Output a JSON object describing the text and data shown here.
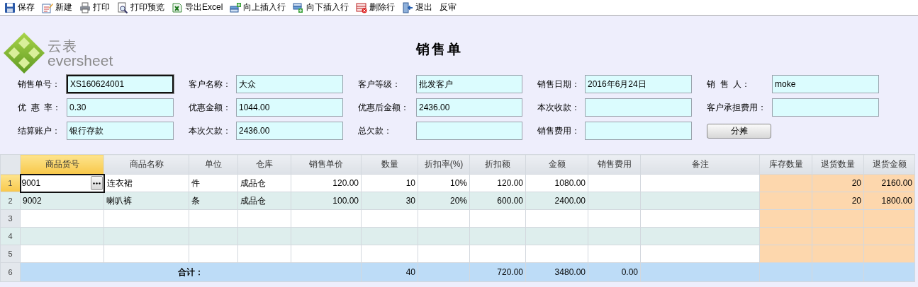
{
  "toolbar": [
    {
      "kind": "save",
      "label": "保存"
    },
    {
      "kind": "new",
      "label": "新建"
    },
    {
      "kind": "print",
      "label": "打印"
    },
    {
      "kind": "preview",
      "label": "打印预览"
    },
    {
      "kind": "excel",
      "label": "导出Excel"
    },
    {
      "kind": "insert-above",
      "label": "向上插入行"
    },
    {
      "kind": "insert-below",
      "label": "向下插入行"
    },
    {
      "kind": "delete-row",
      "label": "删除行"
    },
    {
      "kind": "exit",
      "label": "退出"
    },
    {
      "kind": "plain",
      "label": "反审"
    }
  ],
  "logo": {
    "mark": "云表",
    "name": "eversheet"
  },
  "title": "销售单",
  "form": {
    "rows": [
      [
        {
          "kind": "field",
          "label": "销售单号：",
          "value": "XS160624001",
          "focused": true
        },
        {
          "kind": "field",
          "label": "客户名称：",
          "value": "大众",
          "focused": false
        },
        {
          "kind": "field",
          "label": "客户等级：",
          "value": "批发客户",
          "focused": false
        },
        {
          "kind": "field",
          "label": "销售日期：",
          "value": "2016年6月24日",
          "focused": false
        },
        {
          "kind": "field",
          "label": "销  售  人：",
          "value": "moke",
          "focused": false
        }
      ],
      [
        {
          "kind": "field",
          "label": "优  惠  率：",
          "value": "0.30",
          "focused": false
        },
        {
          "kind": "field",
          "label": "优惠金额：",
          "value": "1044.00",
          "focused": false
        },
        {
          "kind": "field",
          "label": "优惠后金额：",
          "value": "2436.00",
          "focused": false
        },
        {
          "kind": "field",
          "label": "本次收款：",
          "focused": false
        },
        {
          "kind": "field",
          "label": "客户承担费用：",
          "focused": false
        }
      ],
      [
        {
          "kind": "field",
          "label": "结算账户：",
          "value": "银行存款",
          "focused": false
        },
        {
          "kind": "field",
          "label": "本次欠款：",
          "value": "2436.00",
          "focused": false
        },
        {
          "kind": "field",
          "label": "总欠款：",
          "focused": false
        },
        {
          "kind": "field",
          "label": "销售费用：",
          "focused": false
        },
        {
          "kind": "button",
          "label": "分摊"
        }
      ]
    ]
  },
  "table": {
    "columns": [
      {
        "label": "商品货号",
        "kind": "text",
        "selected": true,
        "highlighted": false
      },
      {
        "label": "商品名称",
        "kind": "text",
        "selected": false,
        "highlighted": false
      },
      {
        "label": "单位",
        "kind": "text",
        "selected": false,
        "highlighted": false
      },
      {
        "label": "仓库",
        "kind": "text",
        "selected": false,
        "highlighted": false
      },
      {
        "label": "销售单价",
        "kind": "number",
        "selected": false,
        "highlighted": false
      },
      {
        "label": "数量",
        "kind": "number",
        "selected": false,
        "highlighted": false
      },
      {
        "label": "折扣率(%)",
        "kind": "number",
        "selected": false,
        "highlighted": false
      },
      {
        "label": "折扣额",
        "kind": "number",
        "selected": false,
        "highlighted": false
      },
      {
        "label": "金额",
        "kind": "number",
        "selected": false,
        "highlighted": false
      },
      {
        "label": "销售费用",
        "kind": "number",
        "selected": false,
        "highlighted": false
      },
      {
        "label": "备注",
        "kind": "text",
        "selected": false,
        "highlighted": false
      },
      {
        "label": "库存数量",
        "kind": "number",
        "selected": false,
        "highlighted": true
      },
      {
        "label": "退货数量",
        "kind": "number",
        "selected": false,
        "highlighted": true
      },
      {
        "label": "退货金额",
        "kind": "number",
        "selected": false,
        "highlighted": true
      }
    ],
    "rows": [
      {
        "number": "1",
        "selected": true,
        "cells": [
          "9001",
          "连衣裙",
          "件",
          "成品仓",
          "120.00",
          "10",
          "10%",
          "120.00",
          "1080.00",
          null,
          null,
          null,
          "20",
          "2160.00"
        ]
      },
      {
        "number": "2",
        "selected": false,
        "cells": [
          "9002",
          "喇叭裤",
          "条",
          "成品仓",
          "100.00",
          "30",
          "20%",
          "600.00",
          "2400.00",
          null,
          null,
          null,
          "20",
          "1800.00"
        ]
      },
      {
        "number": "3",
        "selected": false,
        "cells": [
          null,
          null,
          null,
          null,
          null,
          null,
          null,
          null,
          null,
          null,
          null,
          null,
          null,
          null
        ]
      },
      {
        "number": "4",
        "selected": false,
        "cells": [
          null,
          null,
          null,
          null,
          null,
          null,
          null,
          null,
          null,
          null,
          null,
          null,
          null,
          null
        ]
      },
      {
        "number": "5",
        "selected": false,
        "cells": [
          null,
          null,
          null,
          null,
          null,
          null,
          null,
          null,
          null,
          null,
          null,
          null,
          null,
          null
        ]
      }
    ],
    "total": {
      "number": "6",
      "label": "合计：",
      "cells": [
        "40",
        null,
        "720.00",
        "3480.00",
        "0.00",
        null,
        null,
        null,
        null
      ]
    }
  }
}
